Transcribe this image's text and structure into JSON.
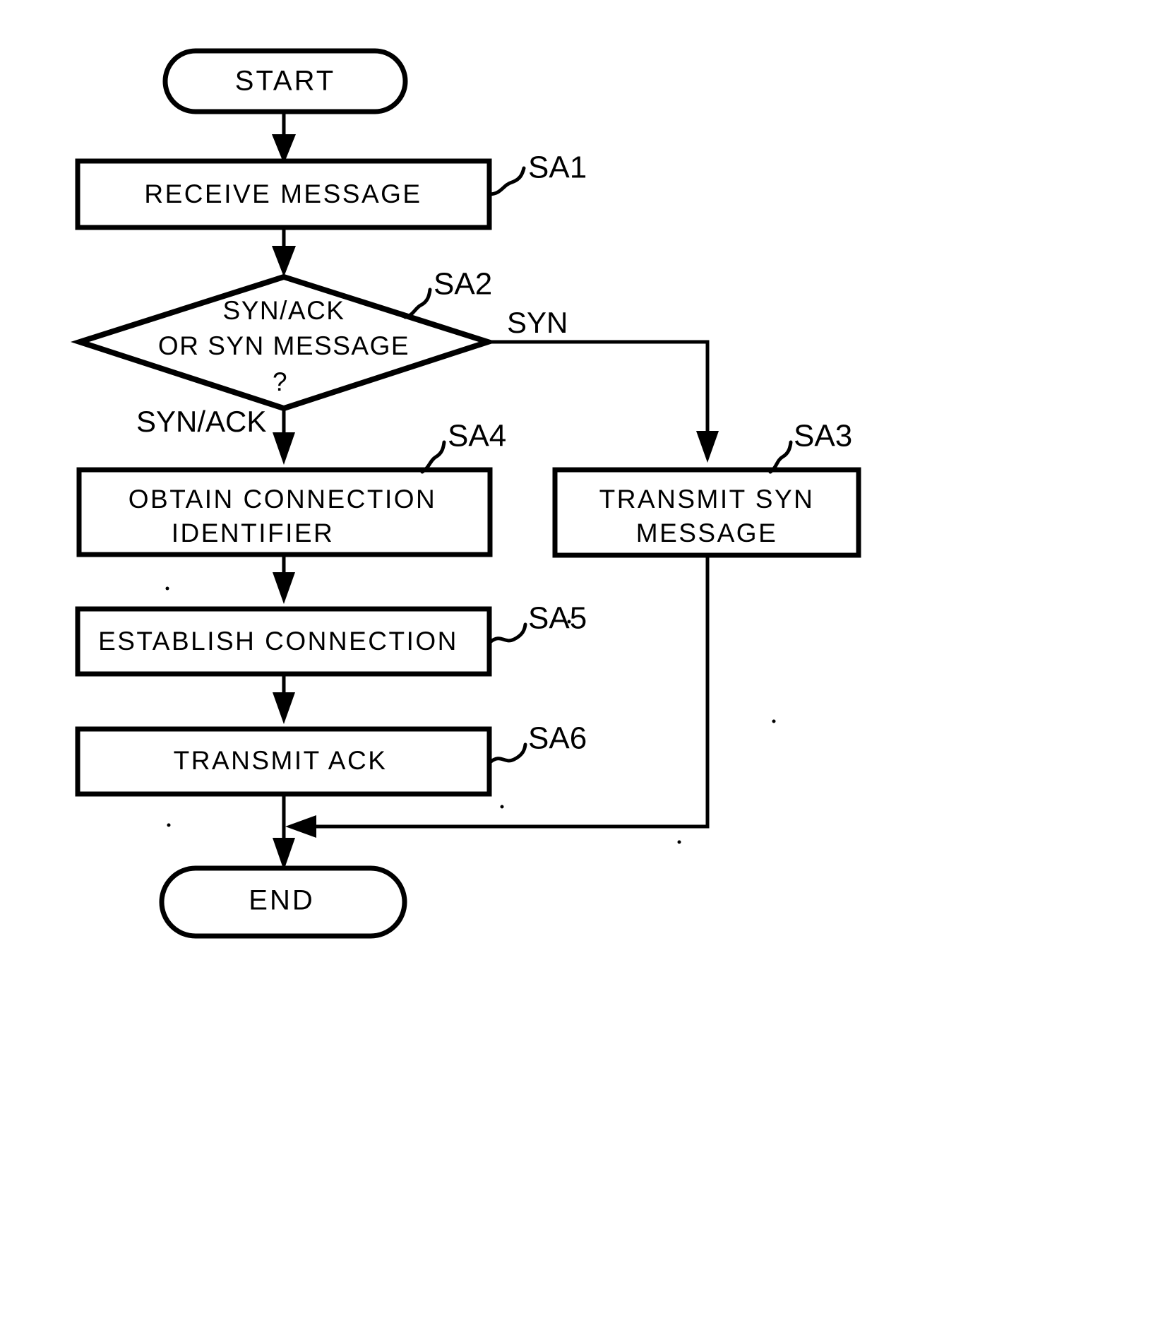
{
  "diagram": {
    "type": "flowchart",
    "title": "",
    "nodes": [
      {
        "id": "start",
        "shape": "terminator",
        "label": "START"
      },
      {
        "id": "sa1",
        "shape": "process",
        "label": "RECEIVE MESSAGE",
        "ref": "SA1"
      },
      {
        "id": "sa2",
        "shape": "decision",
        "label_line1": "SYN/ACK",
        "label_line2": "OR SYN MESSAGE",
        "label_line3": "?",
        "ref": "SA2"
      },
      {
        "id": "sa4",
        "shape": "process",
        "label_line1": "OBTAIN CONNECTION",
        "label_line2": "IDENTIFIER",
        "ref": "SA4"
      },
      {
        "id": "sa3",
        "shape": "process",
        "label_line1": "TRANSMIT SYN",
        "label_line2": "MESSAGE",
        "ref": "SA3"
      },
      {
        "id": "sa5",
        "shape": "process",
        "label": "ESTABLISH CONNECTION",
        "ref": "SA5"
      },
      {
        "id": "sa6",
        "shape": "process",
        "label": "TRANSMIT ACK",
        "ref": "SA6"
      },
      {
        "id": "end",
        "shape": "terminator",
        "label": "END"
      }
    ],
    "edges": [
      {
        "from": "start",
        "to": "sa1",
        "label": ""
      },
      {
        "from": "sa1",
        "to": "sa2",
        "label": ""
      },
      {
        "from": "sa2",
        "to": "sa3",
        "label": "SYN"
      },
      {
        "from": "sa2",
        "to": "sa4",
        "label": "SYN/ACK"
      },
      {
        "from": "sa4",
        "to": "sa5",
        "label": ""
      },
      {
        "from": "sa5",
        "to": "sa6",
        "label": ""
      },
      {
        "from": "sa6",
        "to": "end",
        "label": ""
      },
      {
        "from": "sa3",
        "to": "end",
        "label": ""
      }
    ],
    "refs": {
      "sa1": "SA1",
      "sa2": "SA2",
      "sa3": "SA3",
      "sa4": "SA4",
      "sa5": "SA5",
      "sa6": "SA6"
    },
    "edge_labels": {
      "syn": "SYN",
      "syn_ack": "SYN/ACK"
    },
    "colors": {
      "stroke": "#000000",
      "fill": "#ffffff",
      "background": "#ffffff"
    }
  }
}
